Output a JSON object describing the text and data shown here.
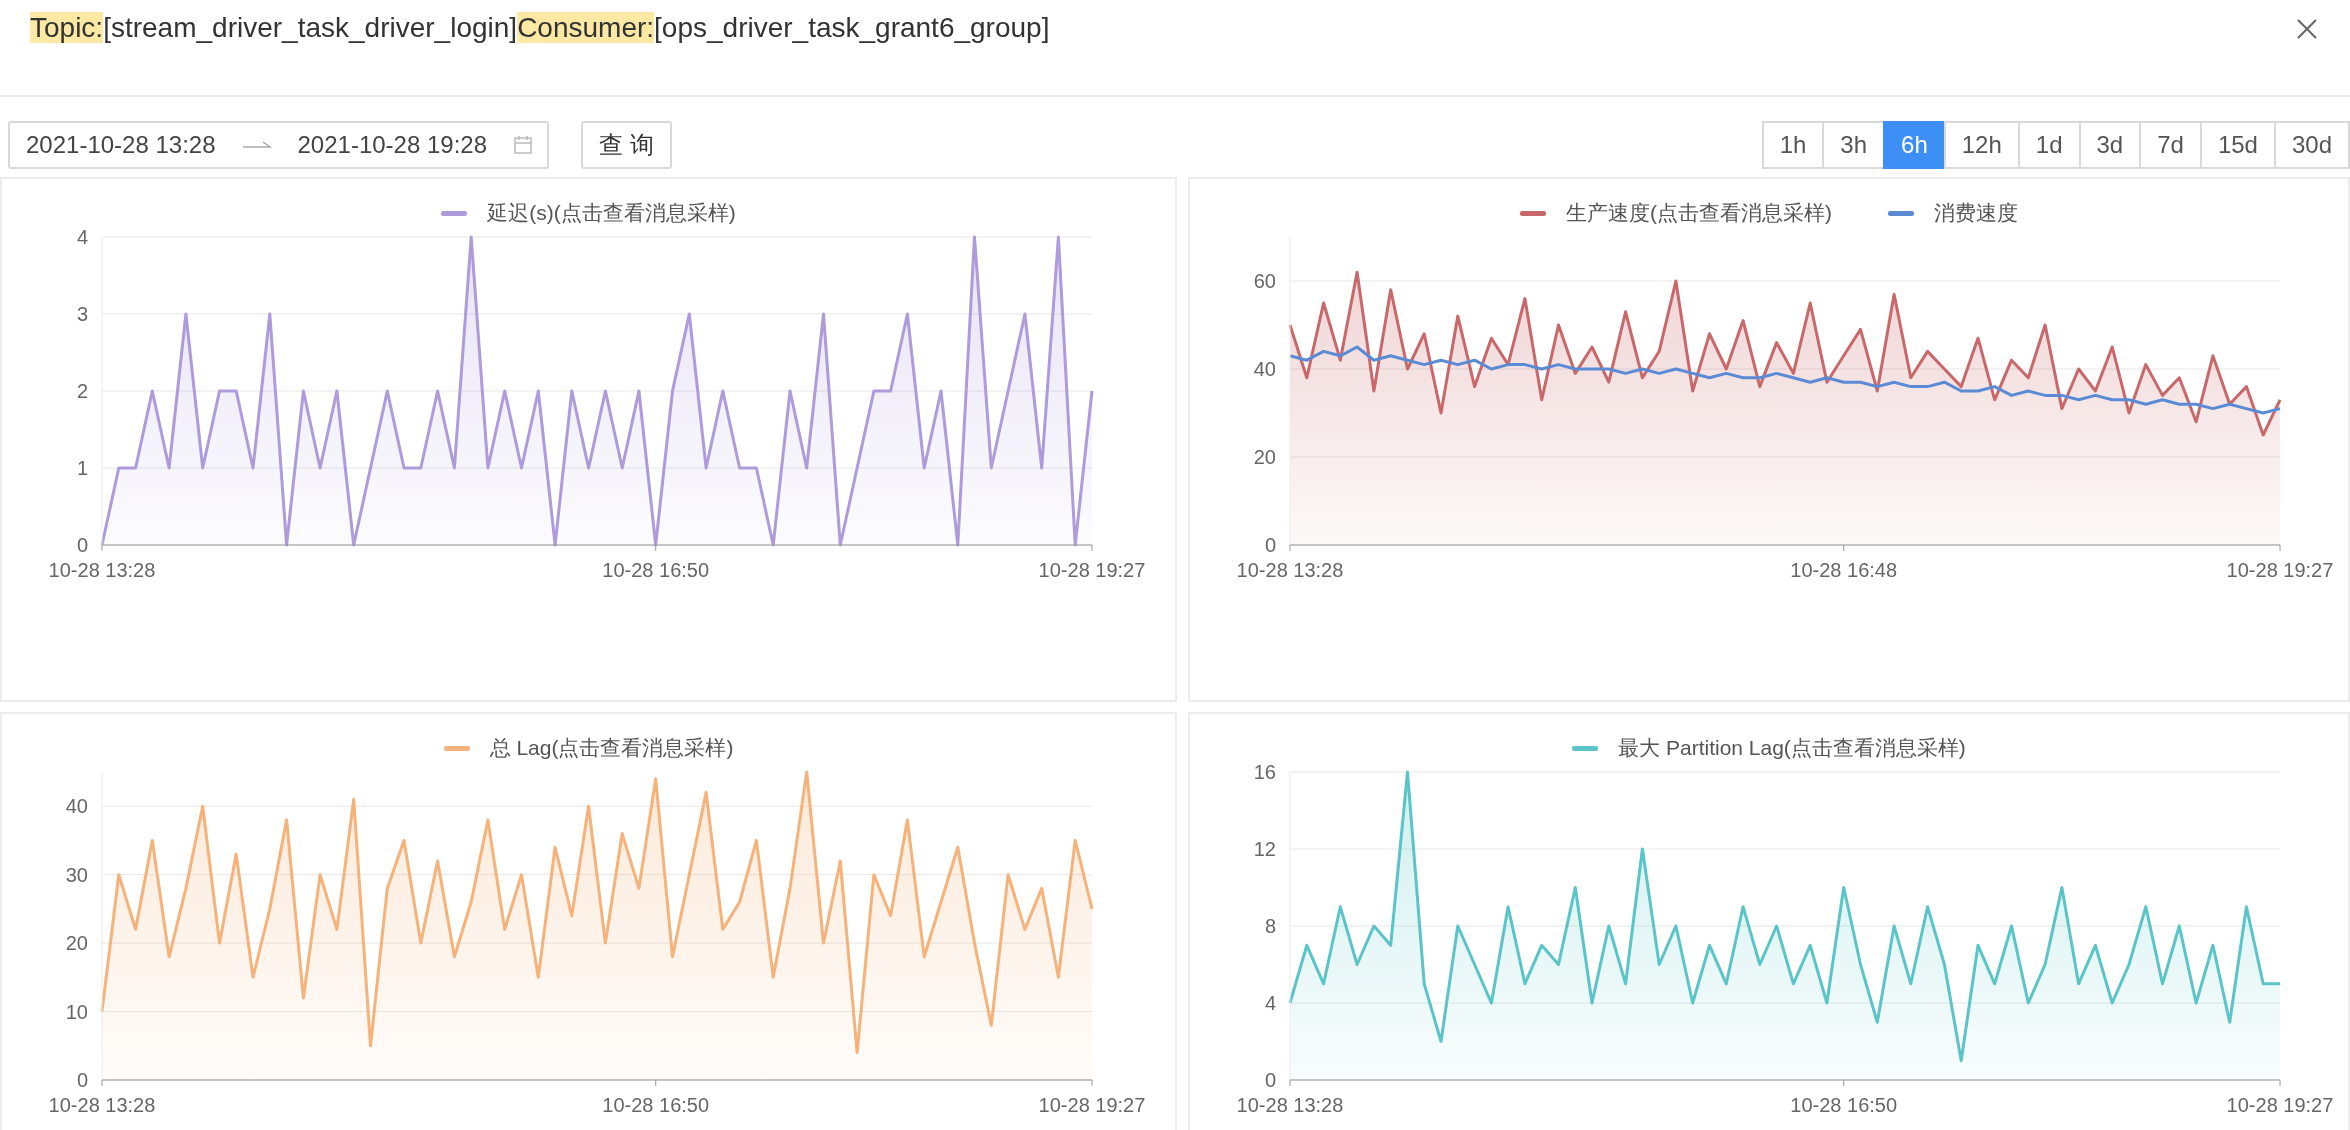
{
  "header": {
    "parts": [
      {
        "label": "Topic:",
        "value": "[stream_driver_task_driver_login]"
      },
      {
        "label": "Consumer:",
        "value": "[ops_driver_task_grant6_group]"
      }
    ]
  },
  "date_range": {
    "start": "2021-10-28 13:28",
    "end": "2021-10-28 19:28"
  },
  "query_button": "查 询",
  "ranges": [
    {
      "label": "1h",
      "selected": false
    },
    {
      "label": "3h",
      "selected": false
    },
    {
      "label": "6h",
      "selected": true
    },
    {
      "label": "12h",
      "selected": false
    },
    {
      "label": "1d",
      "selected": false
    },
    {
      "label": "3d",
      "selected": false
    },
    {
      "label": "7d",
      "selected": false
    },
    {
      "label": "15d",
      "selected": false
    },
    {
      "label": "30d",
      "selected": false
    }
  ],
  "panels": [
    {
      "chart_data": {
        "type": "area",
        "grid": true,
        "categories": [
          "10-28 13:28",
          null,
          null,
          null,
          null,
          null,
          null,
          null,
          null,
          null,
          null,
          null,
          null,
          null,
          null,
          null,
          null,
          null,
          null,
          null,
          null,
          null,
          null,
          null,
          null,
          null,
          null,
          null,
          null,
          null,
          null,
          null,
          null,
          "10-28 16:50",
          null,
          null,
          null,
          null,
          null,
          null,
          null,
          null,
          null,
          null,
          null,
          null,
          null,
          null,
          null,
          null,
          null,
          null,
          null,
          null,
          null,
          null,
          null,
          null,
          null,
          "10-28 19:27"
        ],
        "ylim": [
          0,
          4
        ],
        "yticks": [
          0,
          1,
          2,
          3,
          4
        ],
        "series": [
          {
            "name": "延迟(s)(点击查看消息采样)",
            "color": "#ad9bdc",
            "values": [
              0,
              1,
              1,
              2,
              1,
              3,
              1,
              2,
              2,
              1,
              3,
              0,
              2,
              1,
              2,
              0,
              1,
              2,
              1,
              1,
              2,
              1,
              4,
              1,
              2,
              1,
              2,
              0,
              2,
              1,
              2,
              1,
              2,
              0,
              2,
              3,
              1,
              2,
              1,
              1,
              0,
              2,
              1,
              3,
              0,
              1,
              2,
              2,
              3,
              1,
              2,
              0,
              4,
              1,
              2,
              3,
              1,
              4,
              0,
              2
            ]
          }
        ]
      }
    },
    {
      "chart_data": {
        "type": "area",
        "grid": true,
        "categories": [
          "10-28 13:28",
          null,
          null,
          null,
          null,
          null,
          null,
          null,
          null,
          null,
          null,
          null,
          null,
          null,
          null,
          null,
          null,
          null,
          null,
          null,
          null,
          null,
          null,
          null,
          null,
          null,
          null,
          null,
          null,
          null,
          null,
          null,
          null,
          "10-28 16:48",
          null,
          null,
          null,
          null,
          null,
          null,
          null,
          null,
          null,
          null,
          null,
          null,
          null,
          null,
          null,
          null,
          null,
          null,
          null,
          null,
          null,
          null,
          null,
          null,
          null,
          "10-28 19:27"
        ],
        "ylim": [
          0,
          70
        ],
        "yticks": [
          0,
          20,
          40,
          60
        ],
        "series": [
          {
            "name": "生产速度(点击查看消息采样)",
            "color": "#c9686b",
            "values": [
              50,
              38,
              55,
              42,
              62,
              35,
              58,
              40,
              48,
              30,
              52,
              36,
              47,
              41,
              56,
              33,
              50,
              39,
              45,
              37,
              53,
              38,
              44,
              60,
              35,
              48,
              40,
              51,
              36,
              46,
              39,
              55,
              37,
              43,
              49,
              35,
              57,
              38,
              44,
              40,
              36,
              47,
              33,
              42,
              38,
              50,
              31,
              40,
              35,
              45,
              30,
              41,
              34,
              38,
              28,
              43,
              32,
              36,
              25,
              33
            ]
          },
          {
            "name": "消费速度",
            "type": "line",
            "color": "#5b8bd4",
            "values": [
              43,
              42,
              44,
              43,
              45,
              42,
              43,
              42,
              41,
              42,
              41,
              42,
              40,
              41,
              41,
              40,
              41,
              40,
              40,
              40,
              39,
              40,
              39,
              40,
              39,
              38,
              39,
              38,
              38,
              39,
              38,
              37,
              38,
              37,
              37,
              36,
              37,
              36,
              36,
              37,
              35,
              35,
              36,
              34,
              35,
              34,
              34,
              33,
              34,
              33,
              33,
              32,
              33,
              32,
              32,
              31,
              32,
              31,
              30,
              31
            ]
          }
        ]
      }
    },
    {
      "chart_data": {
        "type": "area",
        "grid": true,
        "categories": [
          "10-28 13:28",
          null,
          null,
          null,
          null,
          null,
          null,
          null,
          null,
          null,
          null,
          null,
          null,
          null,
          null,
          null,
          null,
          null,
          null,
          null,
          null,
          null,
          null,
          null,
          null,
          null,
          null,
          null,
          null,
          null,
          null,
          null,
          null,
          "10-28 16:50",
          null,
          null,
          null,
          null,
          null,
          null,
          null,
          null,
          null,
          null,
          null,
          null,
          null,
          null,
          null,
          null,
          null,
          null,
          null,
          null,
          null,
          null,
          null,
          null,
          null,
          "10-28 19:27"
        ],
        "ylim": [
          0,
          45
        ],
        "yticks": [
          0,
          10,
          20,
          30,
          40
        ],
        "series": [
          {
            "name": "总 Lag(点击查看消息采样)",
            "color": "#f5b27a",
            "values": [
              10,
              30,
              22,
              35,
              18,
              28,
              40,
              20,
              33,
              15,
              25,
              38,
              12,
              30,
              22,
              41,
              5,
              28,
              35,
              20,
              32,
              18,
              26,
              38,
              22,
              30,
              15,
              34,
              24,
              40,
              20,
              36,
              28,
              44,
              18,
              30,
              42,
              22,
              26,
              35,
              15,
              28,
              45,
              20,
              32,
              4,
              30,
              24,
              38,
              18,
              26,
              34,
              20,
              8,
              30,
              22,
              28,
              15,
              35,
              25
            ]
          }
        ]
      }
    },
    {
      "chart_data": {
        "type": "area",
        "grid": true,
        "categories": [
          "10-28 13:28",
          null,
          null,
          null,
          null,
          null,
          null,
          null,
          null,
          null,
          null,
          null,
          null,
          null,
          null,
          null,
          null,
          null,
          null,
          null,
          null,
          null,
          null,
          null,
          null,
          null,
          null,
          null,
          null,
          null,
          null,
          null,
          null,
          "10-28 16:50",
          null,
          null,
          null,
          null,
          null,
          null,
          null,
          null,
          null,
          null,
          null,
          null,
          null,
          null,
          null,
          null,
          null,
          null,
          null,
          null,
          null,
          null,
          null,
          null,
          null,
          "10-28 19:27"
        ],
        "ylim": [
          0,
          16
        ],
        "yticks": [
          0,
          4,
          8,
          12,
          16
        ],
        "series": [
          {
            "name": "最大 Partition Lag(点击查看消息采样)",
            "color": "#5bc4c8",
            "values": [
              4,
              7,
              5,
              9,
              6,
              8,
              7,
              16,
              5,
              2,
              8,
              6,
              4,
              9,
              5,
              7,
              6,
              10,
              4,
              8,
              5,
              12,
              6,
              8,
              4,
              7,
              5,
              9,
              6,
              8,
              5,
              7,
              4,
              10,
              6,
              3,
              8,
              5,
              9,
              6,
              1,
              7,
              5,
              8,
              4,
              6,
              10,
              5,
              7,
              4,
              6,
              9,
              5,
              8,
              4,
              7,
              3,
              9,
              5,
              5
            ]
          }
        ]
      }
    }
  ]
}
